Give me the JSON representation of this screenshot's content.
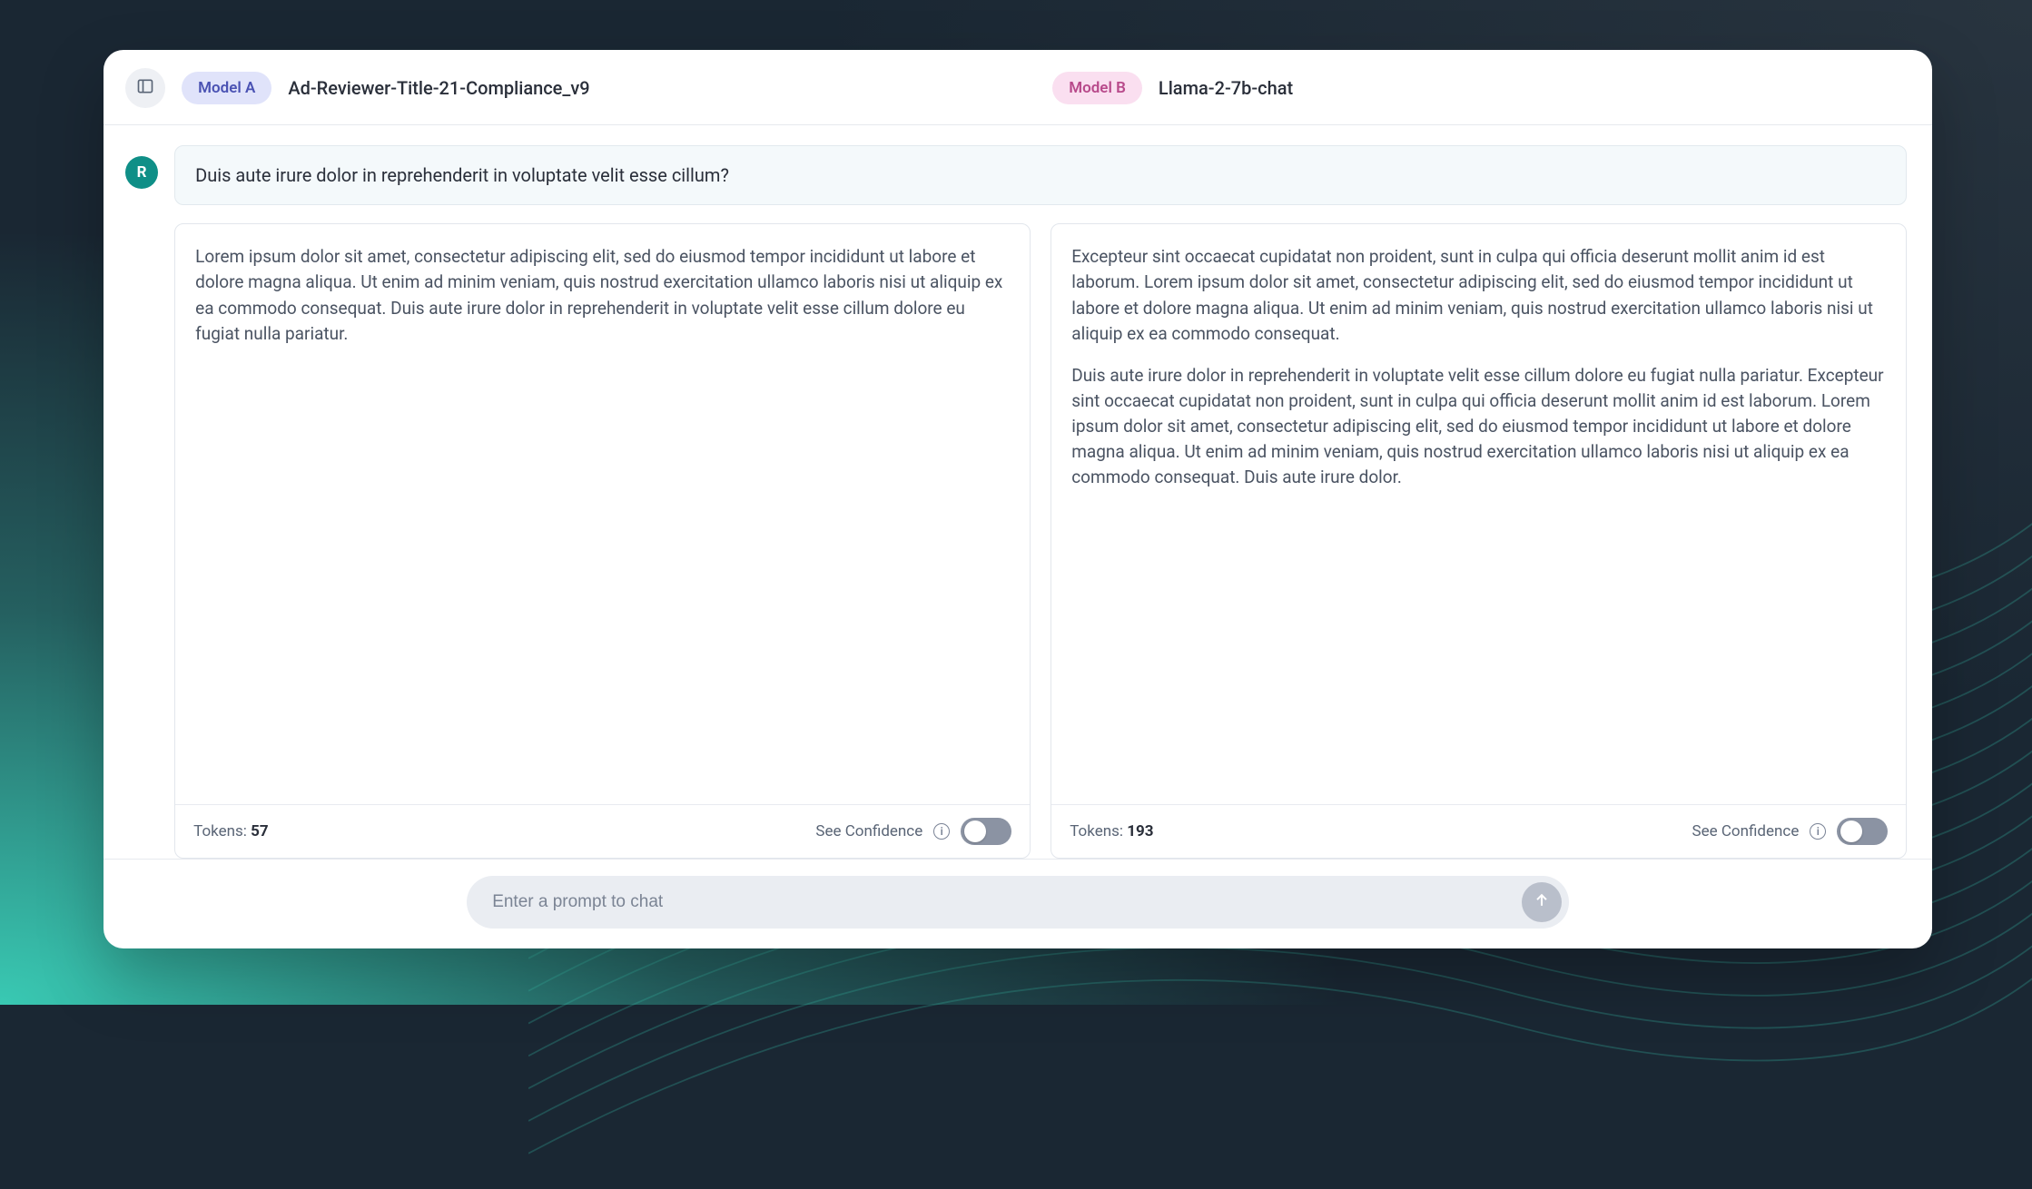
{
  "header": {
    "model_a_pill": "Model A",
    "model_a_name": "Ad-Reviewer-Title-21-Compliance_v9",
    "model_b_pill": "Model B",
    "model_b_name": "Llama-2-7b-chat"
  },
  "avatar_letter": "R",
  "prompt_text": "Duis aute irure dolor in reprehenderit in voluptate velit esse cillum?",
  "responses": {
    "a": {
      "para1": "Lorem ipsum dolor sit amet, consectetur adipiscing elit, sed do eiusmod tempor incididunt ut labore et dolore magna aliqua. Ut enim ad minim veniam, quis nostrud exercitation ullamco laboris nisi ut aliquip ex ea commodo consequat. Duis aute irure dolor in reprehenderit in voluptate velit esse cillum dolore eu fugiat nulla pariatur.",
      "tokens_label": "Tokens: ",
      "tokens_value": "57",
      "confidence_label": "See Confidence"
    },
    "b": {
      "para1": "Excepteur sint occaecat cupidatat non proident, sunt in culpa qui officia deserunt mollit anim id est laborum. Lorem ipsum dolor sit amet, consectetur adipiscing elit, sed do eiusmod tempor incididunt ut labore et dolore magna aliqua. Ut enim ad minim veniam, quis nostrud exercitation ullamco laboris nisi ut aliquip ex ea commodo consequat.",
      "para2": "Duis aute irure dolor in reprehenderit in voluptate velit esse cillum dolore eu fugiat nulla pariatur. Excepteur sint occaecat cupidatat non proident, sunt in culpa qui officia deserunt mollit anim id est laborum. Lorem ipsum dolor sit amet, consectetur adipiscing elit, sed do eiusmod tempor incididunt ut labore et dolore magna aliqua. Ut enim ad minim veniam, quis nostrud exercitation ullamco laboris nisi ut aliquip ex ea commodo consequat. Duis aute irure dolor.",
      "tokens_label": "Tokens: ",
      "tokens_value": "193",
      "confidence_label": "See Confidence"
    }
  },
  "footer": {
    "placeholder": "Enter a prompt to chat"
  },
  "info_glyph": "i"
}
